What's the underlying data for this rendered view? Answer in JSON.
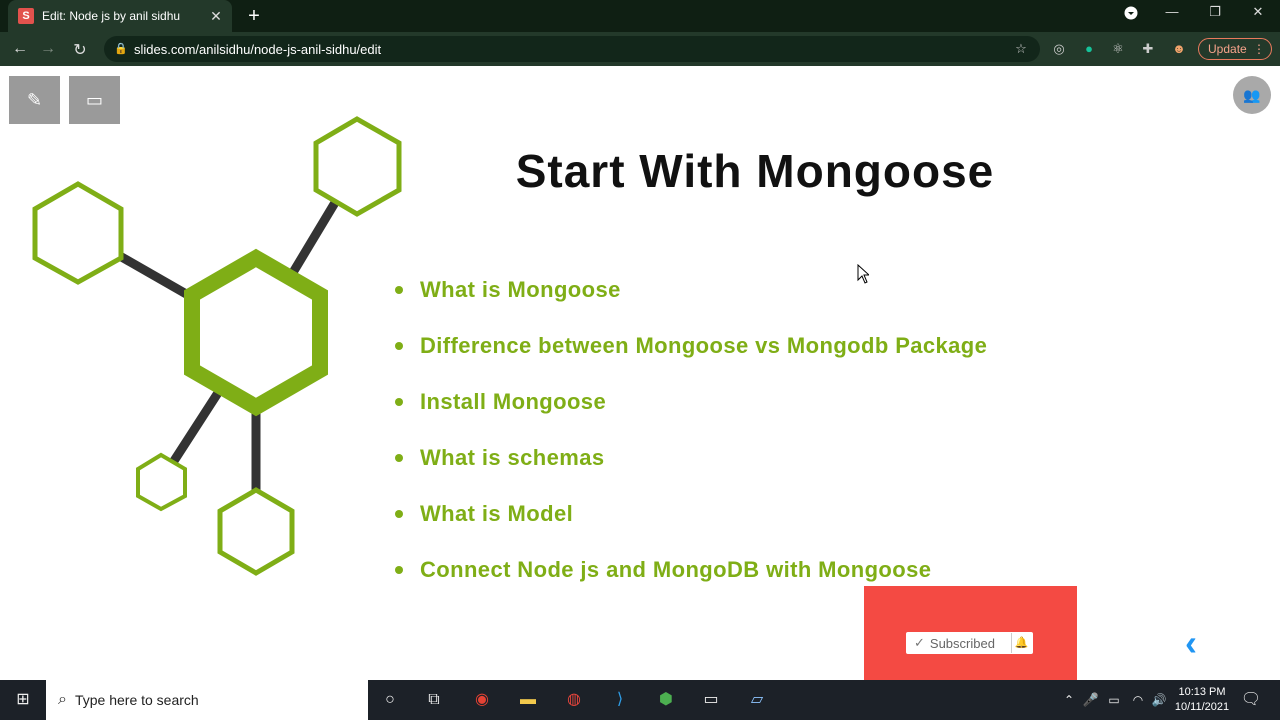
{
  "browser": {
    "tab_title": "Edit: Node js by anil sidhu",
    "tab_favicon": "S",
    "tab_close": "✕",
    "new_tab": "+",
    "url": "slides.com/anilsidhu/node-js-anil-sidhu/edit",
    "update_label": "Update",
    "colors": {
      "chrome_dark": "#0f1f13",
      "chrome_bar": "#23392a",
      "favicon": "#e2524d"
    }
  },
  "toolbar": {
    "edit_icon": "pencil-icon",
    "present_icon": "monitor-icon",
    "collab_icon": "people-icon"
  },
  "slide": {
    "title": "Start With Mongoose",
    "bullets": [
      "What is Mongoose",
      "Difference between Mongoose vs Mongodb Package",
      "Install Mongoose",
      "What is schemas",
      "What is Model",
      "Connect Node js and MongoDB with Mongoose"
    ],
    "colors": {
      "accent": "#7fae16",
      "connector": "#333333",
      "title": "#111111"
    }
  },
  "subscribe": {
    "label": "Subscribed",
    "check": "✓",
    "colors": {
      "box": "#f44a43"
    }
  },
  "nav": {
    "prev_arrow": "‹",
    "color": "#2196f3"
  },
  "taskbar": {
    "search_placeholder": "Type here to search",
    "time": "10:13 PM",
    "date": "10/11/2021"
  }
}
